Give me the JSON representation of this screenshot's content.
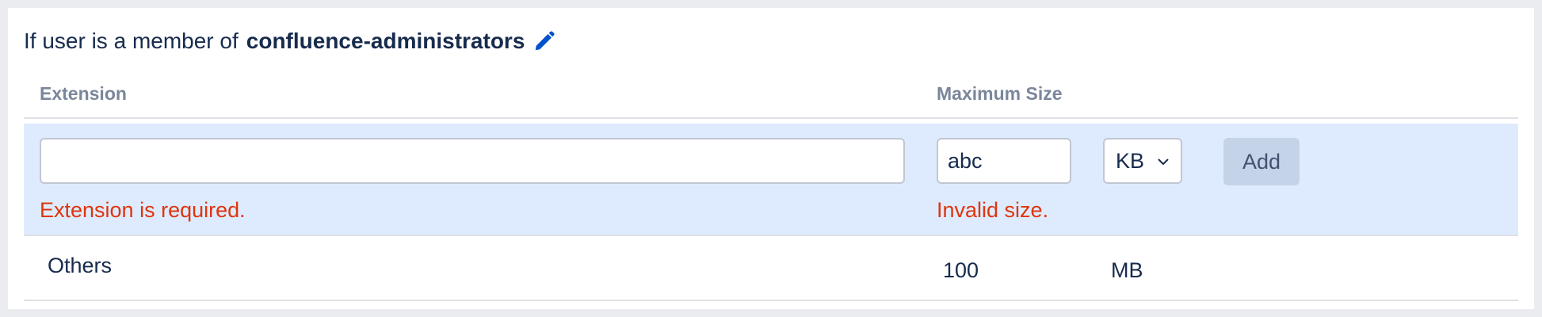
{
  "group": {
    "prefix": "If user is a member of",
    "name": "confluence-administrators",
    "edit_icon": "pencil-icon"
  },
  "table": {
    "headers": {
      "extension": "Extension",
      "max_size": "Maximum Size"
    },
    "new_entry": {
      "extension_value": "",
      "size_value": "abc",
      "unit_selected": "KB",
      "add_label": "Add",
      "extension_error": "Extension is required.",
      "size_error": "Invalid size."
    },
    "rows": [
      {
        "extension": "Others",
        "size": "100",
        "unit": "MB"
      }
    ]
  },
  "colors": {
    "accent": "#0052cc",
    "error": "#de350b",
    "edit_row_bg": "#deebff",
    "add_button_bg": "#c5d3e8"
  }
}
